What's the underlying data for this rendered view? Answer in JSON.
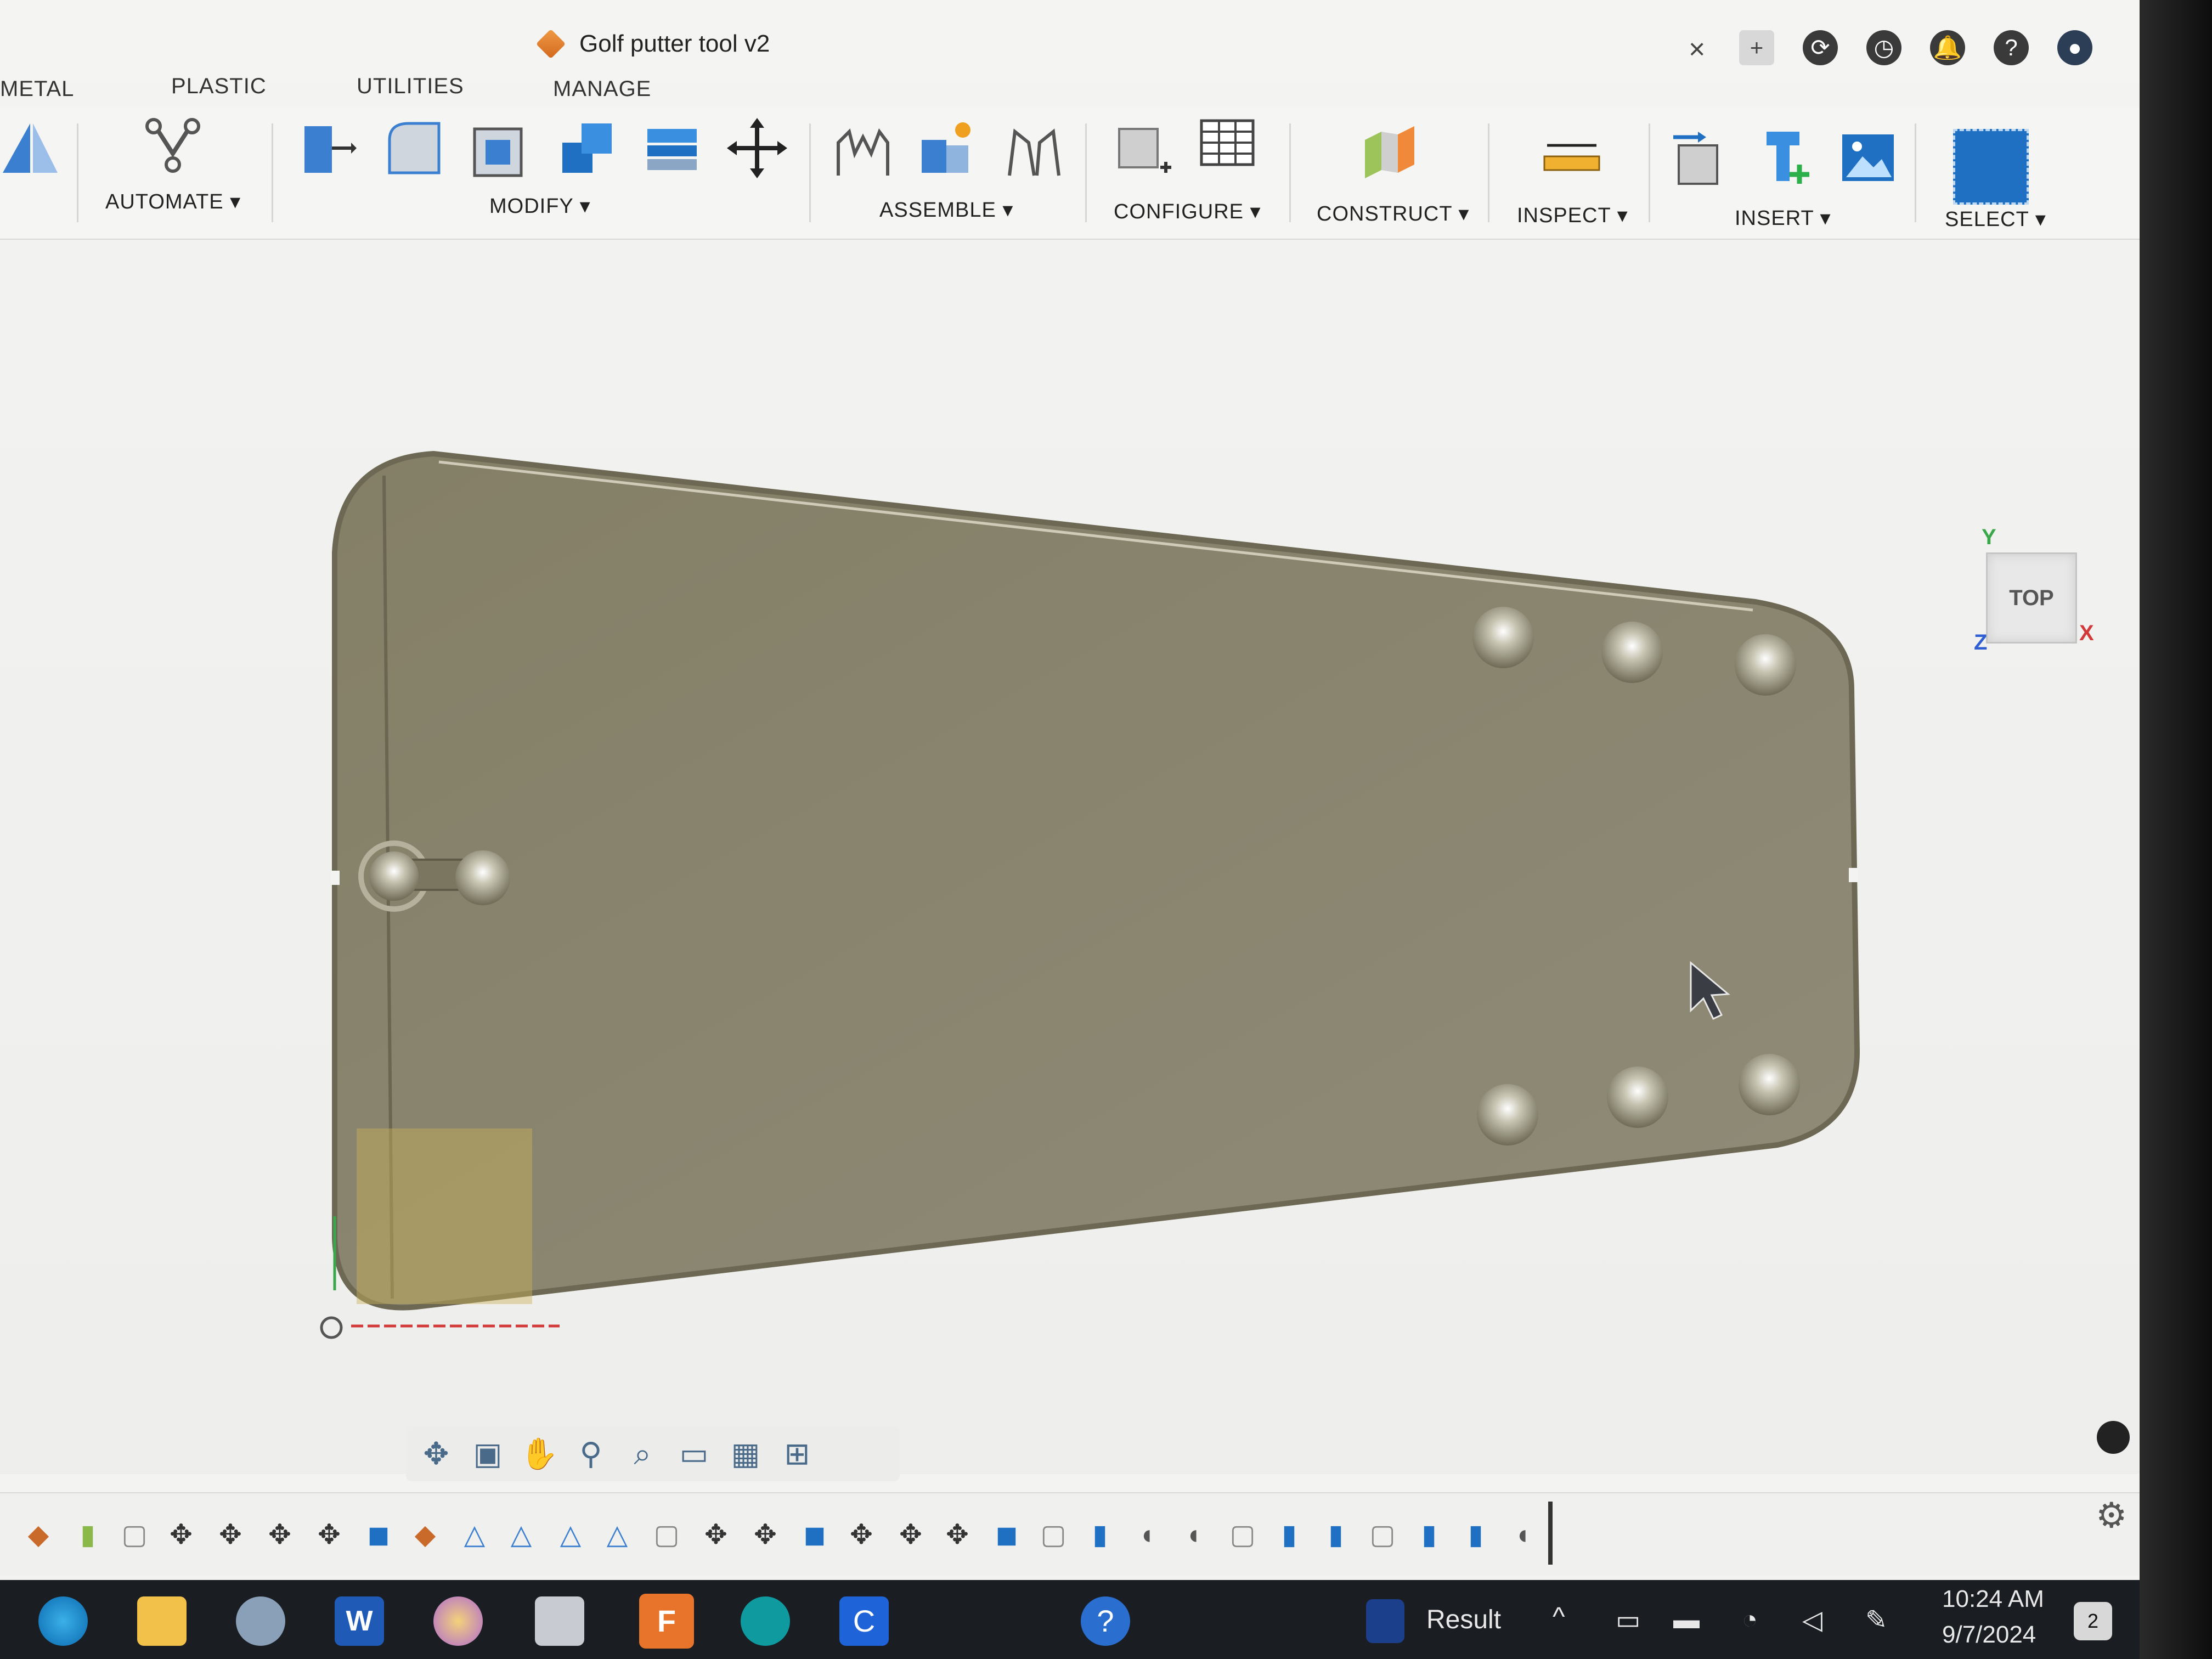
{
  "window": {
    "title": "Golf putter tool v2",
    "close_glyph": "×",
    "header_icons": [
      "new-tab-icon",
      "refresh-icon",
      "clock-icon",
      "bell-icon",
      "help-icon",
      "account-icon"
    ]
  },
  "tabs": [
    {
      "label": "METAL"
    },
    {
      "label": "PLASTIC"
    },
    {
      "label": "UTILITIES"
    },
    {
      "label": "MANAGE"
    }
  ],
  "toolbar": {
    "groups": [
      {
        "label": "AUTOMATE ▾"
      },
      {
        "label": "MODIFY ▾"
      },
      {
        "label": "ASSEMBLE ▾"
      },
      {
        "label": "CONFIGURE ▾"
      },
      {
        "label": "CONSTRUCT ▾"
      },
      {
        "label": "INSPECT ▾"
      },
      {
        "label": "INSERT ▾"
      },
      {
        "label": "SELECT ▾"
      }
    ]
  },
  "viewcube": {
    "face": "TOP",
    "axis_x": "X",
    "axis_y": "Y",
    "axis_z": "Z"
  },
  "colors": {
    "part": "#8a8670",
    "part_edge": "#6f6b58",
    "accent_blue": "#1f6fc2",
    "axis_x": "#d23a3a",
    "axis_y": "#3aa84a",
    "axis_z": "#2f5fd0"
  },
  "taskbar": {
    "search_result": "Result",
    "time": "10:24 AM",
    "date": "9/7/2024",
    "notification_count": "2"
  }
}
